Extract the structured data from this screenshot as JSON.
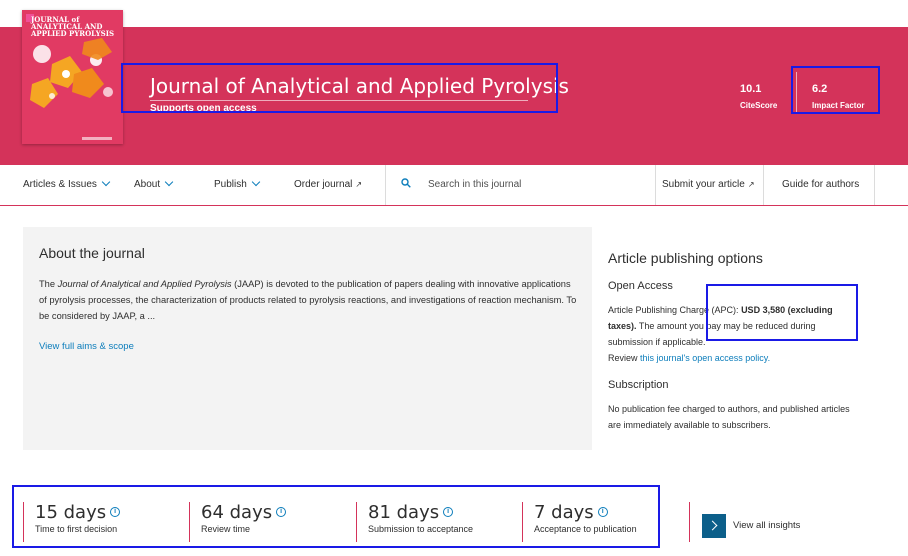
{
  "header": {
    "cover_title": "JOURNAL of ANALYTICAL AND APPLIED PYROLYSIS",
    "title": "Journal of Analytical and Applied Pyrolysis",
    "subtitle": "Supports open access",
    "metrics": [
      {
        "value": "10.1",
        "label": "CiteScore"
      },
      {
        "value": "6.2",
        "label": "Impact Factor"
      }
    ],
    "colors": {
      "banner": "#d4335a",
      "accent": "#0c7dbb",
      "highlight_box": "#1a1ae6"
    }
  },
  "nav": {
    "articles": "Articles & Issues",
    "about": "About",
    "publish": "Publish",
    "order": "Order journal",
    "search_placeholder": "Search in this journal",
    "submit": "Submit your article",
    "guide": "Guide for authors"
  },
  "about": {
    "heading": "About the journal",
    "text_before": "The ",
    "text_em": "Journal of Analytical and Applied Pyrolysis",
    "text_after": " (JAAP) is devoted to the publication of papers dealing with innovative applications of pyrolysis processes, the characterization of products related to pyrolysis reactions, and investigations of reaction mechanism. To be considered by JAAP, a ...",
    "link": "View full aims & scope"
  },
  "publishing": {
    "heading": "Article publishing options",
    "open_access": {
      "heading": "Open Access",
      "apc_prefix": "Article Publishing Charge (APC): ",
      "apc_value": "USD 3,580 (excluding taxes).",
      "apc_suffix": " The amount you pay may be reduced during submission if applicable.",
      "review_prefix": "Review ",
      "review_link": "this journal's open access policy."
    },
    "subscription": {
      "heading": "Subscription",
      "text": "No publication fee charged to authors, and published articles are immediately available to subscribers."
    }
  },
  "insights": {
    "stats": [
      {
        "value": "15 days",
        "label": "Time to first decision"
      },
      {
        "value": "64 days",
        "label": "Review time"
      },
      {
        "value": "81 days",
        "label": "Submission to acceptance"
      },
      {
        "value": "7 days",
        "label": "Acceptance to publication"
      }
    ],
    "view_all": "View all insights"
  }
}
